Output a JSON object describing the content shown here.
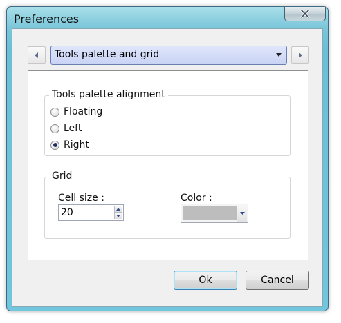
{
  "window": {
    "title": "Preferences"
  },
  "selector": {
    "selected": "Tools palette and grid"
  },
  "alignment": {
    "legend": "Tools palette alignment",
    "options": [
      "Floating",
      "Left",
      "Right"
    ],
    "selected": "Right"
  },
  "grid": {
    "legend": "Grid",
    "cell_size_label": "Cell size :",
    "cell_size_value": "20",
    "color_label": "Color :",
    "color_value": "#bdbdbd"
  },
  "buttons": {
    "ok": "Ok",
    "cancel": "Cancel"
  }
}
